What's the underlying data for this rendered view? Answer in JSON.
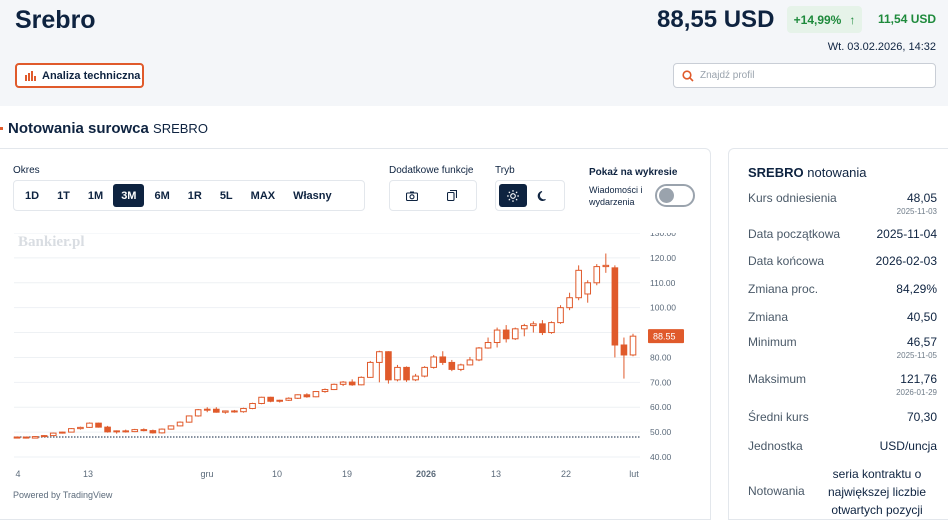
{
  "header": {
    "title": "Srebro",
    "price": "88,55 USD",
    "change_pct": "+14,99%",
    "change_arrow": "↑",
    "change_abs": "11,54 USD",
    "datetime": "Wt. 03.02.2026, 14:32",
    "ta_button": "Analiza techniczna",
    "search_placeholder": "Znajdź profil"
  },
  "section": {
    "title": "Notowania surowca",
    "subtitle": "SREBRO"
  },
  "controls": {
    "period_label": "Okres",
    "periods": [
      "1D",
      "1T",
      "1M",
      "3M",
      "6M",
      "1R",
      "5L",
      "MAX",
      "Własny"
    ],
    "active_period": "3M",
    "extra_label": "Dodatkowe funkcje",
    "mode_label": "Tryb",
    "show_label": "Pokaż na wykresie",
    "show_option": "Wiadomości i wydarzenia"
  },
  "chart_data": {
    "type": "candlestick",
    "watermark": "Bankier.pl",
    "reference_line": 48.05,
    "last_price_label": "88.55",
    "ylim": [
      40,
      130
    ],
    "y_ticks": [
      "130.00",
      "120.00",
      "110.00",
      "100.00",
      "90.00",
      "80.00",
      "70.00",
      "60.00",
      "50.00",
      "40.00"
    ],
    "x_ticks": [
      "4",
      "13",
      "gru",
      "10",
      "19",
      "2026",
      "13",
      "22",
      "lut"
    ],
    "candles": [
      [
        47.8,
        48.3,
        47.6,
        48.0
      ],
      [
        48.0,
        48.2,
        47.4,
        47.6
      ],
      [
        47.6,
        48.4,
        47.5,
        48.2
      ],
      [
        48.2,
        48.8,
        48.0,
        48.6
      ],
      [
        48.6,
        49.8,
        48.5,
        49.6
      ],
      [
        49.6,
        50.2,
        49.4,
        50.0
      ],
      [
        50.0,
        51.6,
        49.9,
        51.4
      ],
      [
        51.4,
        52.2,
        51.0,
        51.9
      ],
      [
        51.9,
        53.9,
        51.7,
        53.6
      ],
      [
        53.6,
        53.8,
        51.8,
        52.0
      ],
      [
        52.0,
        52.5,
        49.8,
        50.1
      ],
      [
        50.1,
        50.7,
        49.4,
        50.5
      ],
      [
        50.5,
        51.0,
        49.8,
        50.2
      ],
      [
        50.2,
        51.3,
        50.0,
        51.0
      ],
      [
        51.0,
        51.5,
        50.3,
        50.6
      ],
      [
        50.6,
        51.0,
        49.4,
        49.7
      ],
      [
        49.7,
        51.5,
        49.4,
        51.2
      ],
      [
        51.2,
        52.7,
        51.0,
        52.5
      ],
      [
        52.5,
        54.3,
        52.3,
        54.0
      ],
      [
        54.0,
        56.7,
        53.8,
        56.5
      ],
      [
        56.5,
        59.3,
        56.2,
        59.0
      ],
      [
        59.0,
        60.0,
        58.0,
        59.2
      ],
      [
        59.2,
        60.0,
        57.8,
        58.0
      ],
      [
        58.0,
        58.7,
        57.4,
        58.5
      ],
      [
        58.5,
        58.9,
        57.8,
        58.2
      ],
      [
        58.2,
        59.8,
        57.8,
        59.5
      ],
      [
        59.5,
        61.8,
        59.2,
        61.5
      ],
      [
        61.5,
        64.2,
        61.2,
        64.0
      ],
      [
        64.0,
        64.2,
        62.0,
        62.4
      ],
      [
        62.4,
        63.0,
        61.9,
        62.8
      ],
      [
        62.8,
        64.0,
        62.5,
        63.6
      ],
      [
        63.6,
        65.2,
        63.3,
        65.0
      ],
      [
        65.0,
        65.6,
        63.8,
        64.2
      ],
      [
        64.2,
        66.5,
        64.0,
        66.3
      ],
      [
        66.3,
        67.5,
        65.8,
        67.1
      ],
      [
        67.1,
        69.5,
        66.9,
        69.2
      ],
      [
        69.2,
        70.5,
        68.5,
        70.1
      ],
      [
        70.1,
        71.2,
        68.6,
        69.0
      ],
      [
        69.0,
        72.4,
        68.8,
        72.0
      ],
      [
        72.0,
        78.6,
        71.8,
        78.0
      ],
      [
        78.0,
        82.7,
        70.0,
        82.3
      ],
      [
        82.3,
        82.5,
        69.5,
        71.0
      ],
      [
        71.0,
        77.0,
        70.4,
        76.0
      ],
      [
        76.0,
        76.4,
        70.2,
        71.0
      ],
      [
        71.0,
        73.4,
        70.5,
        72.5
      ],
      [
        72.5,
        76.5,
        72.0,
        76.0
      ],
      [
        76.0,
        81.0,
        75.5,
        80.2
      ],
      [
        80.2,
        82.5,
        77.0,
        78.0
      ],
      [
        78.0,
        79.0,
        74.5,
        75.2
      ],
      [
        75.2,
        77.5,
        74.5,
        77.0
      ],
      [
        77.0,
        80.2,
        76.8,
        79.0
      ],
      [
        79.0,
        84.2,
        78.5,
        83.8
      ],
      [
        83.8,
        88.0,
        83.5,
        86.0
      ],
      [
        86.0,
        92.0,
        84.0,
        91.0
      ],
      [
        91.0,
        93.0,
        86.0,
        87.5
      ],
      [
        87.5,
        92.0,
        87.0,
        91.5
      ],
      [
        91.5,
        93.5,
        88.5,
        92.8
      ],
      [
        92.8,
        94.5,
        90.0,
        93.5
      ],
      [
        93.5,
        95.0,
        89.0,
        90.0
      ],
      [
        90.0,
        94.5,
        89.5,
        94.0
      ],
      [
        94.0,
        101.0,
        93.5,
        100.0
      ],
      [
        100.0,
        106.0,
        99.0,
        104.0
      ],
      [
        104.0,
        117.0,
        103.0,
        115.0
      ],
      [
        105.5,
        111.0,
        102.0,
        110.0
      ],
      [
        110.0,
        117.5,
        109.0,
        116.5
      ],
      [
        116.5,
        121.76,
        114.0,
        117.0
      ],
      [
        116.0,
        117.0,
        80.0,
        85.0
      ],
      [
        85.0,
        88.0,
        71.5,
        81.0
      ],
      [
        81.0,
        89.5,
        80.5,
        88.55
      ]
    ]
  },
  "chart_footer": "Powered by TradingView",
  "info": {
    "title_bold": "SREBRO",
    "title_rest": "notowania",
    "rows": [
      {
        "label": "Kurs odniesienia",
        "value": "48,05",
        "sub": "2025-11-03"
      },
      {
        "label": "Data początkowa",
        "value": "2025-11-04",
        "sub": ""
      },
      {
        "label": "Data końcowa",
        "value": "2026-02-03",
        "sub": ""
      },
      {
        "label": "Zmiana proc.",
        "value": "84,29%",
        "sub": ""
      },
      {
        "label": "Zmiana",
        "value": "40,50",
        "sub": ""
      },
      {
        "label": "Minimum",
        "value": "46,57",
        "sub": "2025-11-05"
      },
      {
        "label": "Maksimum",
        "value": "121,76",
        "sub": "2026-01-29"
      },
      {
        "label": "Średni kurs",
        "value": "70,30",
        "sub": ""
      },
      {
        "label": "Jednostka",
        "value": "USD/uncja",
        "sub": ""
      }
    ],
    "notowania_label": "Notowania",
    "notowania_value": "seria kontraktu o największej liczbie otwartych pozycji"
  },
  "colors": {
    "accent": "#e05a2b",
    "navy": "#0e2340",
    "positive": "#1e8a3c",
    "positive_bg": "#e6f3e9"
  },
  "icons": {
    "chart": "bar-chart-icon",
    "search": "magnifier-icon",
    "arrow": "arrow-up-icon",
    "camera": "camera-icon",
    "copy": "copy-icon",
    "sun": "sun-icon",
    "moon": "moon-icon"
  }
}
